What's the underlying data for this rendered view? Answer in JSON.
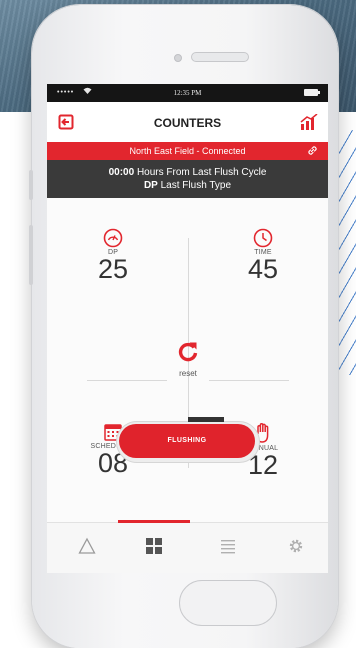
{
  "status_bar": {
    "signal": "•••••",
    "time": "12:35 PM"
  },
  "header": {
    "title": "COUNTERS"
  },
  "connection": {
    "text": "North East Field - Connected"
  },
  "info": {
    "line1_value": "00:00",
    "line1_text": "Hours From Last Flush Cycle",
    "line2_value": "DP",
    "line2_text": "Last Flush Type"
  },
  "counters": {
    "dp": {
      "label": "DP",
      "value": "25",
      "icon": "gauge-icon"
    },
    "time": {
      "label": "TIME",
      "value": "45",
      "icon": "clock-icon"
    },
    "scheduler": {
      "label": "SCHEDULER",
      "value": "08",
      "icon": "calendar-icon"
    },
    "manual": {
      "label": "MANUAL",
      "value": "12",
      "icon": "hand-icon"
    }
  },
  "reset": {
    "label": "reset"
  },
  "flush": {
    "label": "FLUSHING"
  },
  "tabs": [
    {
      "name": "alert",
      "icon": "triangle-icon"
    },
    {
      "name": "dashboard",
      "icon": "grid-icon",
      "active": true
    },
    {
      "name": "list",
      "icon": "list-icon"
    },
    {
      "name": "settings",
      "icon": "gear-icon"
    }
  ],
  "colors": {
    "accent": "#e2262e",
    "info_bar": "#3a3a3a",
    "status_bar": "#151515"
  }
}
